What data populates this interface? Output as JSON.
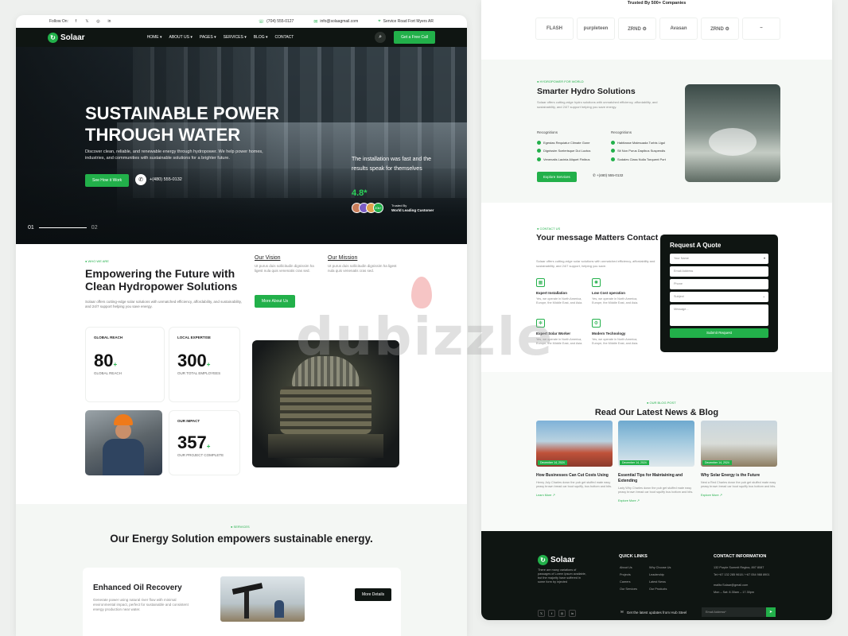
{
  "left": {
    "topbar": {
      "follow": "Follow On:",
      "social": [
        "f",
        "𝕏",
        "◎",
        "in"
      ],
      "phone": "(704) 555-0127",
      "email": "info@solaagmail.com",
      "address": "Service Road Fort Myers AR"
    },
    "nav": {
      "logo": "Solaar",
      "menu": [
        "HOME ▾",
        "ABOUT US ▾",
        "PAGES ▾",
        "SERVICES ▾",
        "BLOG ▾",
        "CONTACT"
      ],
      "cta": "Get a Free Call"
    },
    "hero": {
      "title": "SUSTAINABLE POWER THROUGH WATER",
      "subtitle": "Discover clean, reliable, and renewable energy through hydropower. We help power homes, industries, and communities with sustainable solutions for a brighter future.",
      "button": "See How it Work",
      "phone": "+(480) 555-0132",
      "quote": "The installation was fast and the results speak for themselves",
      "rating": "4.8*",
      "avatar_extra": "20k+",
      "trusted_by": "Trusted By",
      "trusted_label": "World Leading Customer",
      "slide_current": "01",
      "slide_next": "02"
    },
    "about": {
      "tag": "● WHO WE ARE",
      "title": "Empowering the Future with Clean Hydropower Solutions",
      "text": "Solaar offers cutting-edge solar solutions with unmatched efficiency, affordability, and sustainability, and 24/7 support helping you save energy.",
      "vision_title": "Our Vision",
      "vision_text": "Ut purus duis sollicitudin dignissim ha ligest nula quis venenatis cras sed.",
      "mission_title": "Our Mission",
      "mission_text": "Ut purus duis sollicitudin dignissim ha ligest nula quis venenatis cras sed.",
      "button": "More About Us"
    },
    "stats": [
      {
        "label": "GLOBAL REACH",
        "number": "80",
        "suffix": "+",
        "sub": "GLOBAL REACH"
      },
      {
        "label": "LOCAL EXPERTISE",
        "number": "300",
        "suffix": "+",
        "sub": "OUR TOTAL EMPLOYEES"
      },
      {
        "label": "OUR IMPACT",
        "number": "357",
        "suffix": "+",
        "sub": "OUR PROJECT COMPLETE"
      }
    ],
    "energy": {
      "tag": "● SERVICES",
      "title": "Our Energy Solution empowers sustainable energy.",
      "service_title": "Enhanced Oil Recovery",
      "service_text": "Generate power using natural river flow with minimal environmental impact, perfect for sustainable and consistent energy production near water.",
      "service_button": "More Details"
    }
  },
  "right": {
    "trusted": "Trusted By 500+ Companies",
    "brands": [
      "FLASH",
      "purpleteen",
      "ZRND ⚙",
      "Avasan",
      "ZRND ⚙",
      "~"
    ],
    "hydro": {
      "tag": "● HYDROPOWER FOR WORLD",
      "title": "Smarter Hydro Solutions",
      "text": "Solaar offers cutting-edge hydro solutions with unmatched efficiency, affordability, and sustainability, and 24/7 support helping you save energy.",
      "rec_left": "Recognitions",
      "rec_right": "Recognitions",
      "checks_left": [
        "Egestas Requiatur Climate Gone",
        "Dignissim Scelerisque Dui Luctus",
        "Venenatis Lacinia Aliquet Finibus"
      ],
      "checks_right": [
        "Habitasse Malesuada Turbis Ligul",
        "Sit Non Purus Dapibus Suspendis",
        "Sodales Class Nulla Torquent Port"
      ],
      "button": "Explore Services",
      "phone": "+(480) 555-0132"
    },
    "contact": {
      "tag": "● CONTACT US",
      "title": "Your message Matters Contact us",
      "text": "Solaar offers cutting-edge solar solutions with unmatched efficiency, affordability and sustainability, and 24/7 support, helping you save.",
      "features": [
        {
          "title": "Expert Installation",
          "text": "Yes, we operate in North America, Europe, the Middle East, and Asia."
        },
        {
          "title": "Low Cost operation",
          "text": "Yes, we operate in North America, Europe, the Middle East, and Asia."
        },
        {
          "title": "Expert Solar Worker",
          "text": "Yes, we operate in North America, Europe, the Middle East, and Asia."
        },
        {
          "title": "Modern Technology",
          "text": "Yes, we operate in North America, Europe, the Middle East, and Asia."
        }
      ],
      "form_title": "Request A Quote",
      "fields": [
        "Your Name",
        "Email Address",
        "Phone",
        "Subject",
        "Message..."
      ],
      "submit": "Submit Request"
    },
    "blog": {
      "tag": "● OUR BLOG POST",
      "title": "Read Our Latest News & Blog",
      "posts": [
        {
          "date": "December 14, 2024",
          "title": "How Businesses Can Cut Costs Using",
          "text": "Henry July Charles down the pub get stuffed mate easy peasy brown bread car boot squiffy, bus bottom and bits.",
          "more": "Learn More ↗"
        },
        {
          "date": "December 14, 2024",
          "title": "Essential Tips for Maintaining and Extending",
          "text": "Lady Why Charles down the pub get stuffed mate easy peasy brown bread car boot squiffy bus bottom and bits.",
          "more": "Explore More ↗"
        },
        {
          "date": "December 14, 2024",
          "title": "Why Solar Energy is the Future",
          "text": "Nest a Red Charles down the pub get stuffed mate easy peasy brown bread car boot squiffy bus bottom and bits.",
          "more": "Explore More ↗"
        }
      ]
    },
    "footer": {
      "logo": "Solaar",
      "text": "There are many variations of passages of Lorem Ipsum available, but the majority have suffered in some form by injected",
      "quick_title": "QUICK LINKS",
      "quick_col1": [
        "About Us",
        "Projects",
        "Careers",
        "Our Services"
      ],
      "quick_col2": [
        "Why Choose Us",
        "Leadership",
        "Latest News",
        "Our Products"
      ],
      "contact_title": "CONTACT INFORMATION",
      "contact_lines": [
        "132 Purple Summit Regina, 897 8087",
        "Tel:+67 132 285 9618 / +67 054 988 8901",
        "mailto:Solaar@gmail.com",
        "Mon – Sat: 8.30am – 17.30pm"
      ],
      "social": [
        "𝕏",
        "f",
        "◎",
        "in"
      ],
      "newsletter": "Get the latest updates from Hub Steel",
      "email_placeholder": "Email Address*"
    }
  },
  "watermark": "dubizzle"
}
